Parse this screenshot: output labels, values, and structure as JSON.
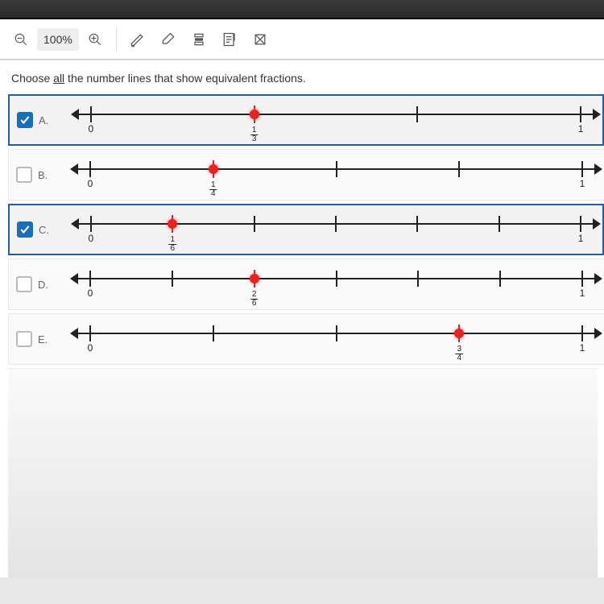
{
  "toolbar": {
    "zoom_label": "100%"
  },
  "question": {
    "prefix": "Choose ",
    "emphasis": "all",
    "suffix": " the number lines that show equivalent fractions."
  },
  "options": [
    {
      "letter": "A.",
      "checked": true,
      "divisions": 3,
      "point_at": 1,
      "point_label_num": "1",
      "point_label_den": "3",
      "label_zero": "0",
      "label_one": "1"
    },
    {
      "letter": "B.",
      "checked": false,
      "divisions": 4,
      "point_at": 1,
      "point_label_num": "1",
      "point_label_den": "4",
      "label_zero": "0",
      "label_one": "1"
    },
    {
      "letter": "C.",
      "checked": true,
      "divisions": 6,
      "point_at": 1,
      "point_label_num": "1",
      "point_label_den": "6",
      "label_zero": "0",
      "label_one": "1"
    },
    {
      "letter": "D.",
      "checked": false,
      "divisions": 6,
      "point_at": 2,
      "point_label_num": "2",
      "point_label_den": "6",
      "label_zero": "0",
      "label_one": "1"
    },
    {
      "letter": "E.",
      "checked": false,
      "divisions": 4,
      "point_at": 3,
      "point_label_num": "3",
      "point_label_den": "4",
      "label_zero": "0",
      "label_one": "1"
    }
  ]
}
